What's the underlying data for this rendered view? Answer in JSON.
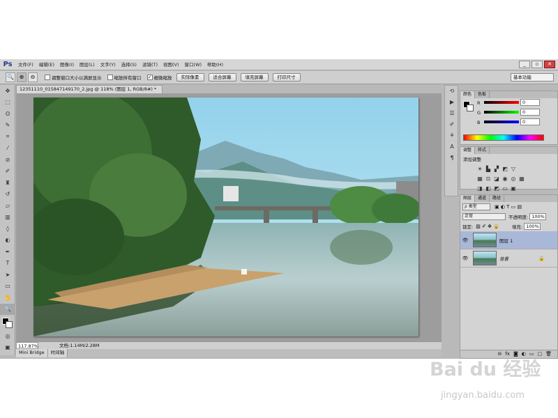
{
  "app": {
    "logo": "Ps",
    "menu": [
      "文件(F)",
      "编辑(E)",
      "图像(I)",
      "图层(L)",
      "文字(Y)",
      "选择(S)",
      "滤镜(T)",
      "视图(V)",
      "窗口(W)",
      "帮助(H)"
    ],
    "window_controls": [
      "_",
      "▫",
      "✕"
    ]
  },
  "options": {
    "checkbox1_label": "调整窗口大小以满屏显示",
    "checkbox1_checked": false,
    "checkbox2_label": "缩放所有窗口",
    "checkbox2_checked": false,
    "checkbox3_label": "细微缩放",
    "checkbox3_checked": true,
    "buttons": [
      "实际像素",
      "适合屏幕",
      "填充屏幕",
      "打印尺寸"
    ],
    "workspace": "基本功能"
  },
  "document": {
    "tab_title": "12351110_015847149170_2.jpg @ 118% (图层 1, RGB/8#) *",
    "zoom": "117.87%",
    "doc_info": "文档:1.14M/2.28M"
  },
  "bottom_tabs": [
    "Mini Bridge",
    "时间轴"
  ],
  "color_panel": {
    "tabs": [
      "颜色",
      "色板"
    ],
    "channels": [
      {
        "label": "R",
        "value": "0"
      },
      {
        "label": "G",
        "value": "0"
      },
      {
        "label": "B",
        "value": "0"
      }
    ]
  },
  "adjust_panel": {
    "tabs": [
      "调整",
      "样式"
    ],
    "title": "添加调整"
  },
  "layers_panel": {
    "tabs": [
      "图层",
      "通道",
      "路径"
    ],
    "filter": "ρ 类型",
    "blend_mode": "正常",
    "opacity_label": "不透明度:",
    "opacity": "100%",
    "lock_label": "锁定:",
    "fill_label": "填充:",
    "fill": "100%",
    "layers": [
      {
        "name": "图层 1",
        "selected": true,
        "locked": false
      },
      {
        "name": "背景",
        "selected": false,
        "locked": true
      }
    ]
  },
  "watermark": {
    "logo": "Bai du 经验",
    "site": "jingyan.baidu.com"
  }
}
